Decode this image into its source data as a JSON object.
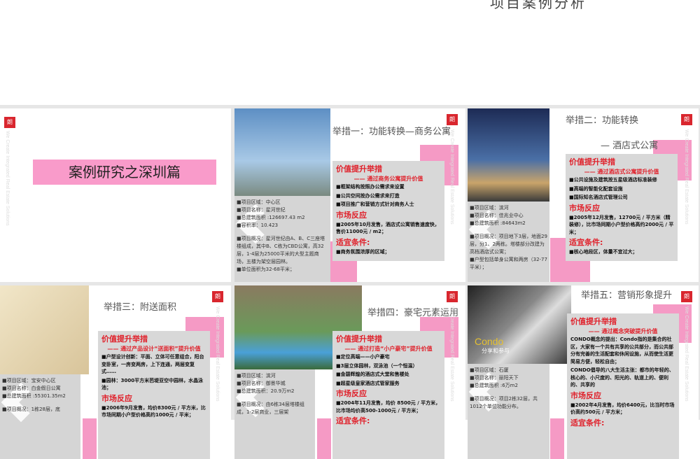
{
  "top_title": "项目案例分析",
  "brand": {
    "logo_text": "朗",
    "tagline": "We Create Integrated Real Estate Solutions"
  },
  "cover": {
    "title": "案例研究之深圳篇"
  },
  "slides": [
    {
      "title": "举措一：功能转换—商务公寓",
      "subtitle": "",
      "info": [
        "■项目区域：中心区",
        "■项目名称：星河世纪",
        "■总建筑面积 :126697.43  m2",
        "■容积率：10.423",
        "",
        "■项目概况：星河世纪由A、B、C三座塔楼组成，其中B、C栋为CBD公寓，高32层，1-4层为25000平米的大型主题商场，五楼为架空层园林。",
        "■单位面积为32-68平米；"
      ],
      "value": {
        "h1": "价值提升举措",
        "sub": "—— 通过商务公寓提升价值",
        "items": [
          "■框架结构按照办公需求来设置",
          "■公共空间按办公需求来打造",
          "■项目推广和营销方式针对商务人士"
        ],
        "h2": "市场反应",
        "market": [
          "■2005年10月发售，酒店式公寓销售速度快，售价11000元 / m2；"
        ],
        "h3": "适宜条件:",
        "cond": [
          "■商务氛围浓厚的区域；"
        ]
      }
    },
    {
      "title": "举措二：功能转换",
      "subtitle": "— 酒店式公寓",
      "info": [
        "■项目区域：滨河",
        "■项目名称：佳兆业中心",
        "■总建筑面积 :84643m2",
        "",
        "■项目概况：项目地下3层，地面29层，分1、2两栋。塔楼部分改建为高档酒店式公寓；",
        "■户型包括单身公寓和两房（32-77平米）；"
      ],
      "value": {
        "h1": "价值提升举措",
        "sub": "—— 通过酒店式公寓提升价值",
        "items": [
          "■公共设施及建筑按五星级酒店标准装修",
          "■高端的智能化配套设施",
          "■国际知名酒店式管理公司"
        ],
        "h2": "市场反应",
        "market": [
          "■2005年12月发售，12700元 / 平方米（精装修），比市场同期小户型价格高约2000元 / 平米；"
        ],
        "h3": "适宜条件:",
        "cond": [
          "■核心地段区，体量不宜过大；"
        ]
      }
    },
    {
      "title": "举措三：附送面积",
      "subtitle": "",
      "info": [
        "■项目区域：宝安中心区",
        "■项目名称：白金假日公寓",
        "■总建筑面积 :55301.35m2",
        "",
        "■项目概况：1栋28层，底"
      ],
      "value": {
        "h1": "价值提升举措",
        "sub": "—— 通过产品设计“送面积”提升价值",
        "items": [
          "■户型设计创新：平面、立体可任意组合，阳台变卧室，一房变两房，上下连通，两层变复式……",
          "■园林：3000平方米芭堤亚空中园林，水晶泳池；"
        ],
        "h2": "市场反应",
        "market": [
          "■2006年9月发售，均价8300元 / 平方米，比市场同期小户型价格高约1000元 / 平米；"
        ],
        "h3": "",
        "cond": []
      }
    },
    {
      "title": "举措四：豪宅元素运用",
      "subtitle": "",
      "info": [
        "■项目区域：滨河",
        "■项目名称：御景华城",
        "■总建筑面积：20.9万m2",
        "",
        "■项目概况：由6栋34层塔楼组成，1-2层商业，三层架"
      ],
      "value": {
        "h1": "价值提升举措",
        "sub": "—— 通过打造“小户豪宅”提升价值",
        "items": [
          "■定位高端——小户豪宅",
          "■3层立体园林，双泳池（一个恒温）",
          "■金碧辉煌的酒店式大堂和售楼处",
          "■超星级皇家酒店式管家服务"
        ],
        "h2": "市场反应",
        "market": [
          "■2004年11月发售，均价 8500元 / 平方米，比市场均价高500-1000元 / 平方米；"
        ],
        "h3": "适宜条件:",
        "cond": []
      }
    },
    {
      "title": "举措五：营销形象提升",
      "subtitle": "",
      "info": [
        "■项目区域：石厦",
        "■项目名称：丽阳天下",
        "■总建筑面积 :6万m2",
        "",
        "■项目概况：项目2栋32层，共1012个单位功能分布。"
      ],
      "value": {
        "h1": "价值提升举措",
        "sub": "—— 通过概念突破提升价值",
        "items": [
          "CONDO概念的提出：Condo指的是集合的社区，大家有一个共有共享的公共部分，而公共部分有完善的生活配套和休闲设施，从而使生活更简易方便，轻松自由；",
          "CONDO倡导的八大生活主张：都市的年轻的、核心的、小尺度的、阳光的、轨道上的、便利的、共享的"
        ],
        "h2": "市场反应",
        "market": [
          "■2002年4月发售，均价6400元，比当时市场价高约500元 / 平方米；"
        ],
        "h3": "适宜条件:",
        "cond": []
      }
    }
  ],
  "photo_captions": {
    "condo": "Condo",
    "condo_cn": "分享和参与"
  }
}
